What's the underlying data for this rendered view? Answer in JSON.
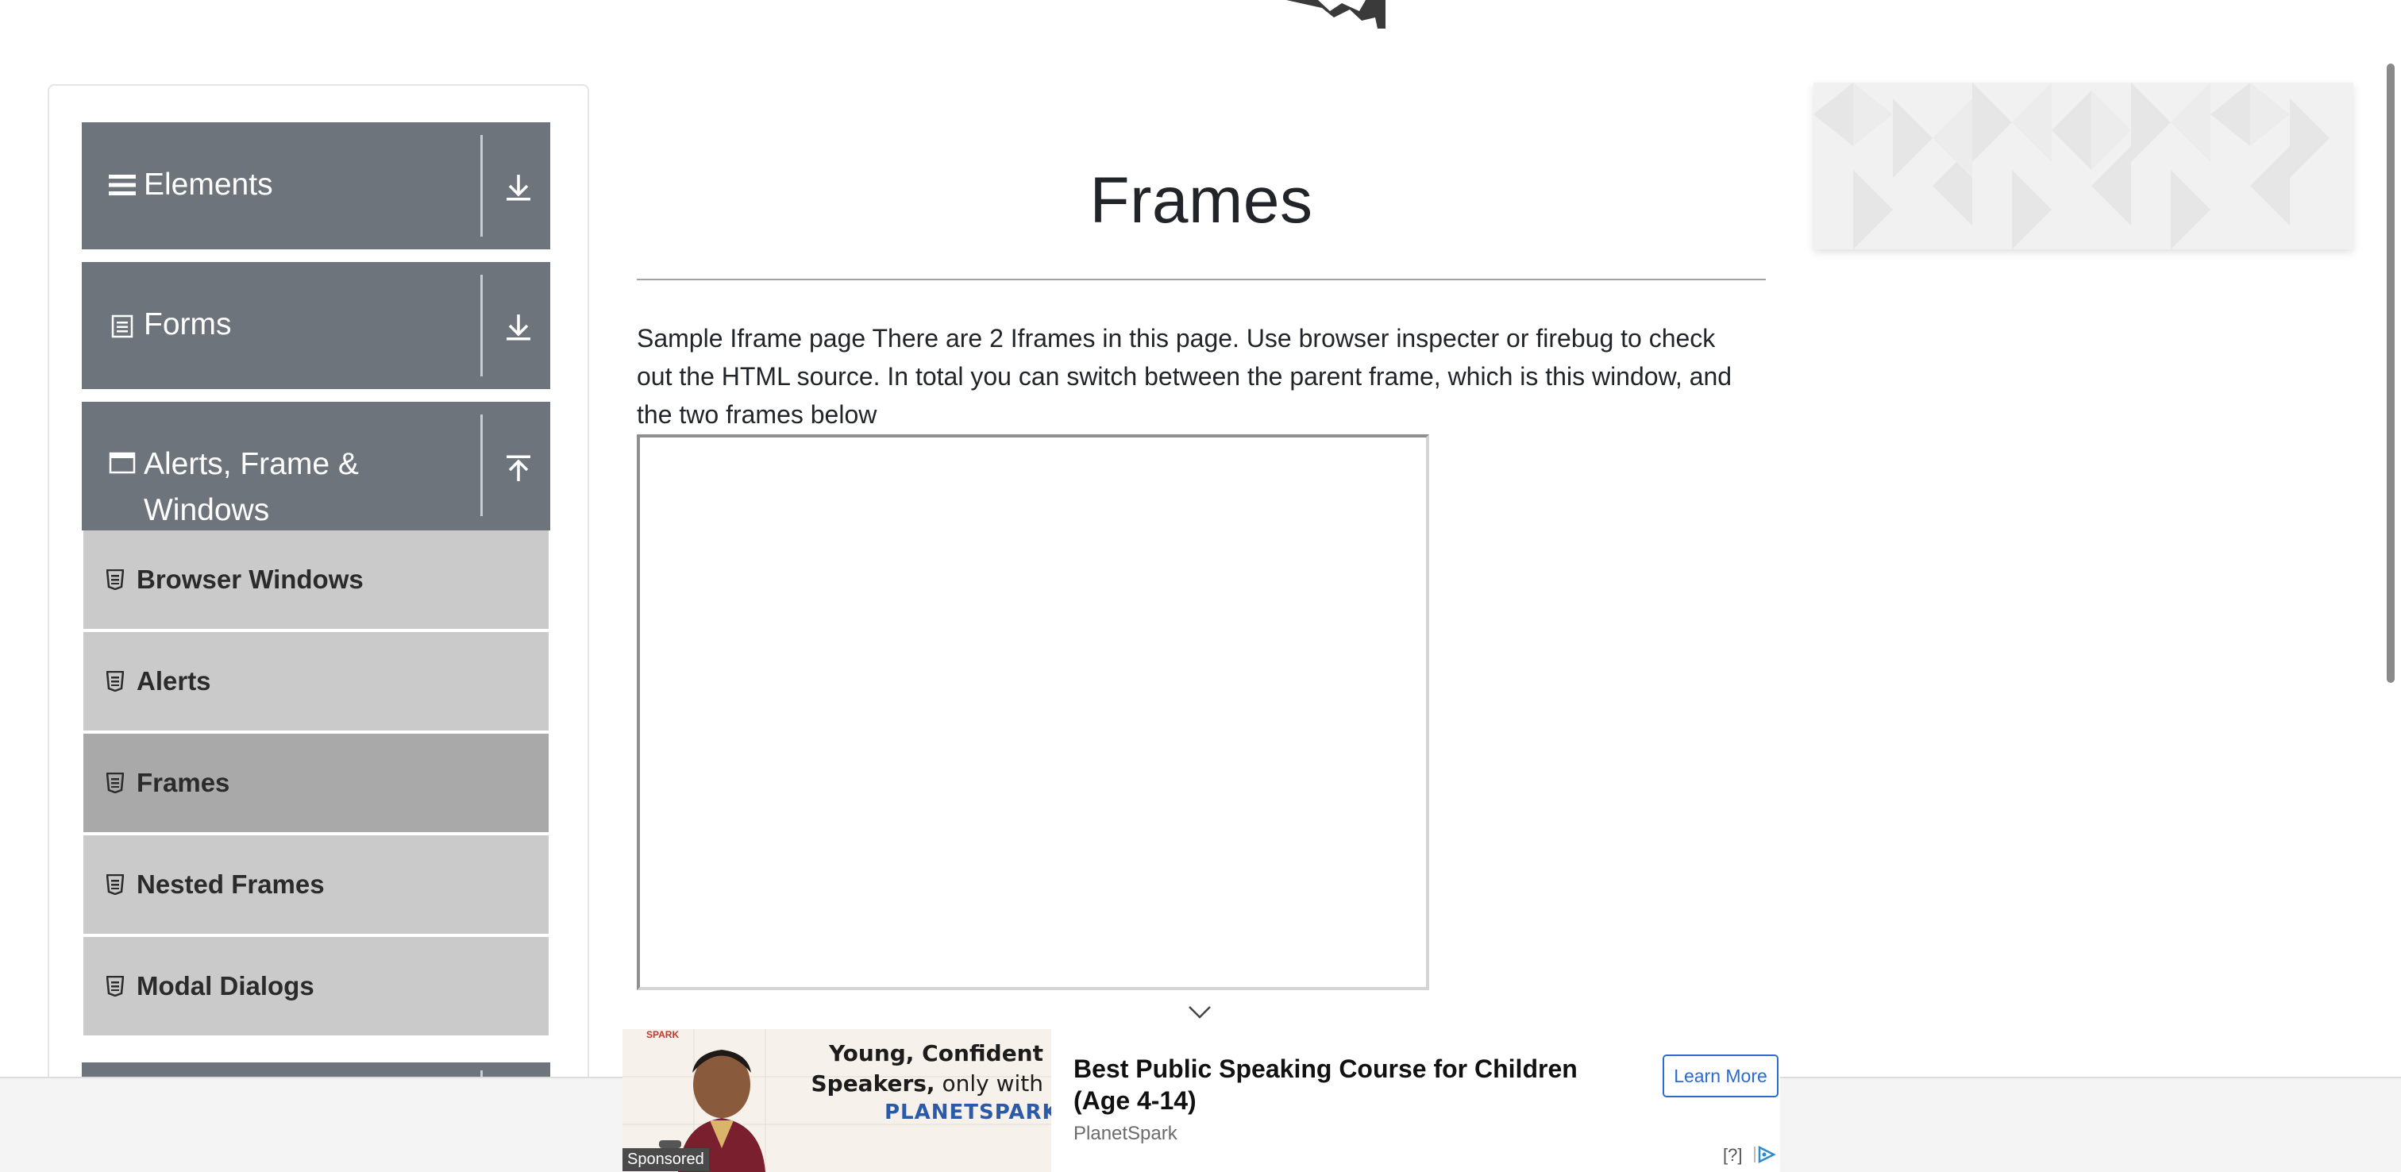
{
  "sidebar": {
    "groups": [
      {
        "label": "Elements"
      },
      {
        "label": "Forms"
      },
      {
        "label": "Alerts, Frame &",
        "label_line2": "Windows"
      }
    ],
    "items": [
      {
        "label": "Browser Windows"
      },
      {
        "label": "Alerts"
      },
      {
        "label": "Frames"
      },
      {
        "label": "Nested Frames"
      },
      {
        "label": "Modal Dialogs"
      }
    ]
  },
  "main": {
    "title": "Frames",
    "description_line1": "Sample Iframe page There are 2 Iframes in this page. Use browser inspecter or firebug to check",
    "description_line2": "out the HTML source. In total you can switch between the parent frame, which is this window, and",
    "description_line3": "the two frames below"
  },
  "ad": {
    "image_line1": "Young, Confident",
    "image_line2_bold": "Speakers,",
    "image_line2_rest": " only with",
    "image_brand": "PLANETSPARK",
    "image_brand_tiny": "SPARK",
    "sponsored": "Sponsored",
    "headline_line1": "Best Public Speaking Course for Children",
    "headline_line2": "(Age 4-14)",
    "source": "PlanetSpark",
    "cta": "Learn More",
    "help": "[?]"
  }
}
